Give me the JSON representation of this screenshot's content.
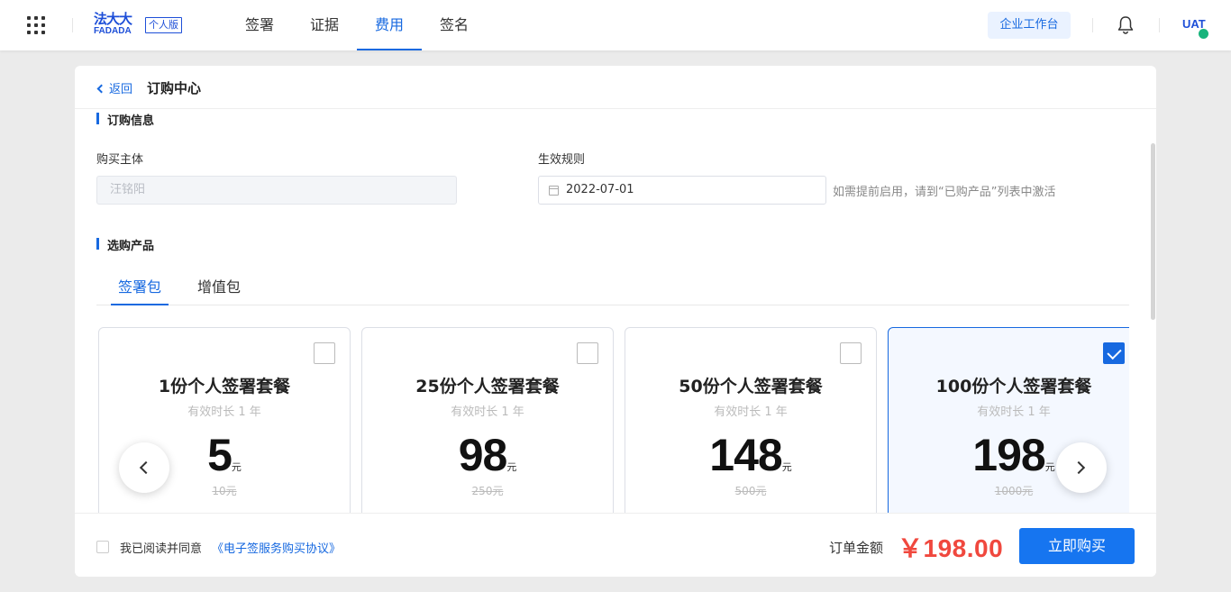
{
  "topbar": {
    "logo_cn": "法大大",
    "logo_en": "FADADA",
    "edition": "个人版",
    "nav": [
      "签署",
      "证据",
      "费用",
      "签名"
    ],
    "active_nav": "费用",
    "workspace_label": "企业工作台",
    "env_badge": "UAT"
  },
  "page": {
    "back_label": "返回",
    "title": "订购中心"
  },
  "order_info": {
    "section_title": "订购信息",
    "buyer_label": "购买主体",
    "buyer_value": "汪铭阳",
    "rule_label": "生效规则",
    "effective_date": "2022-07-01",
    "rule_hint": "如需提前启用，请到“已购产品”列表中激活"
  },
  "products": {
    "section_title": "选购产品",
    "tabs": [
      "签署包",
      "增值包"
    ],
    "active_tab": "签署包",
    "packages": [
      {
        "name": "1份个人签署套餐",
        "validity": "有效时长 1 年",
        "price": "5",
        "unit": "元",
        "original": "10元",
        "selected": false
      },
      {
        "name": "25份个人签署套餐",
        "validity": "有效时长 1 年",
        "price": "98",
        "unit": "元",
        "original": "250元",
        "selected": false
      },
      {
        "name": "50份个人签署套餐",
        "validity": "有效时长 1 年",
        "price": "148",
        "unit": "元",
        "original": "500元",
        "selected": false
      },
      {
        "name": "100份个人签署套餐",
        "validity": "有效时长 1 年",
        "price": "198",
        "unit": "元",
        "original": "1000元",
        "selected": true
      }
    ]
  },
  "footer": {
    "agree_text": "我已阅读并同意",
    "agree_link": "《电子签服务购买协议》",
    "total_label": "订单金额",
    "total_amount": "￥198.00",
    "buy_label": "立即购买"
  },
  "colors": {
    "accent": "#1769e0",
    "price_red": "#f0483e",
    "buy_button": "#1675f0"
  }
}
